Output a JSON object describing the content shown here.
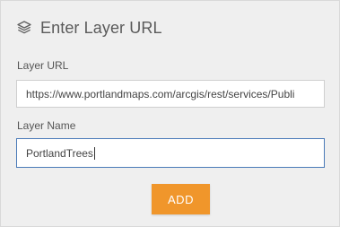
{
  "header": {
    "icon": "layers-icon",
    "title": "Enter Layer URL"
  },
  "form": {
    "url_label": "Layer URL",
    "url_value": "https://www.portlandmaps.com/arcgis/rest/services/Publi",
    "name_label": "Layer Name",
    "name_value": "PortlandTrees",
    "add_label": "ADD"
  },
  "colors": {
    "background": "#efefef",
    "accent_button": "#f0962b",
    "focus_border": "#4a7ab8"
  }
}
